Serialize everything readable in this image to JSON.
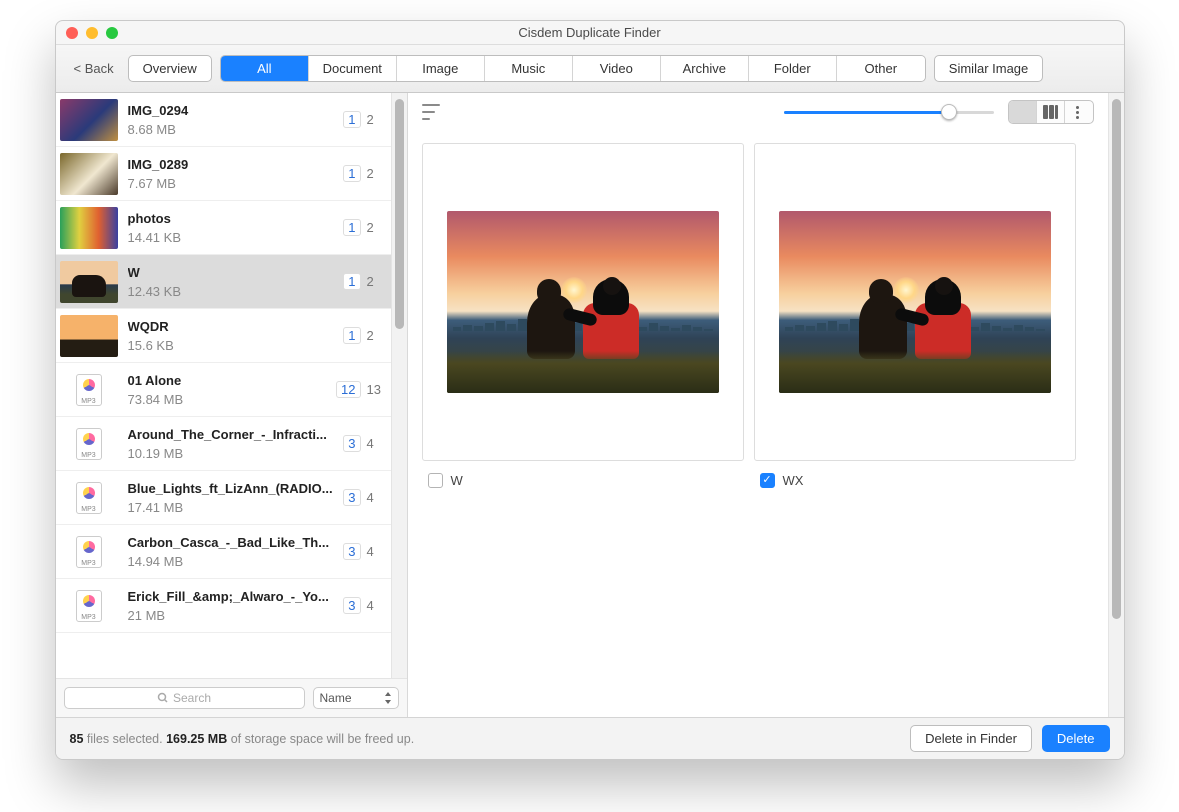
{
  "window": {
    "title": "Cisdem Duplicate Finder"
  },
  "toolbar": {
    "back": "< Back",
    "overview": "Overview",
    "tabs": [
      "All",
      "Document",
      "Image",
      "Music",
      "Video",
      "Archive",
      "Folder",
      "Other"
    ],
    "active_tab_index": 0,
    "similar": "Similar Image"
  },
  "list": {
    "items": [
      {
        "name": "IMG_0294",
        "size": "8.68 MB",
        "sel": "1",
        "tot": "2",
        "kind": "img",
        "thumb": "t0"
      },
      {
        "name": "IMG_0289",
        "size": "7.67 MB",
        "sel": "1",
        "tot": "2",
        "kind": "img",
        "thumb": "t1"
      },
      {
        "name": "photos",
        "size": "14.41 KB",
        "sel": "1",
        "tot": "2",
        "kind": "img",
        "thumb": "t2"
      },
      {
        "name": "W",
        "size": "12.43 KB",
        "sel": "1",
        "tot": "2",
        "kind": "img",
        "thumb": "t3",
        "selected": true
      },
      {
        "name": "WQDR",
        "size": "15.6 KB",
        "sel": "1",
        "tot": "2",
        "kind": "img",
        "thumb": "t4"
      },
      {
        "name": "01 Alone",
        "size": "73.84 MB",
        "sel": "12",
        "tot": "13",
        "kind": "mp3"
      },
      {
        "name": "Around_The_Corner_-_Infracti...",
        "size": "10.19 MB",
        "sel": "3",
        "tot": "4",
        "kind": "mp3"
      },
      {
        "name": "Blue_Lights_ft_LizAnn_(RADIO...",
        "size": "17.41 MB",
        "sel": "3",
        "tot": "4",
        "kind": "mp3"
      },
      {
        "name": "Carbon_Casca_-_Bad_Like_Th...",
        "size": "14.94 MB",
        "sel": "3",
        "tot": "4",
        "kind": "mp3"
      },
      {
        "name": "Erick_Fill_&amp;_Alwaro_-_Yo...",
        "size": "21 MB",
        "sel": "3",
        "tot": "4",
        "kind": "mp3"
      }
    ],
    "search_placeholder": "Search",
    "sort_value": "Name"
  },
  "preview": {
    "slider_pct": 79,
    "cards": [
      {
        "label": "W",
        "checked": false
      },
      {
        "label": "WX",
        "checked": true
      }
    ]
  },
  "footer": {
    "files_count": "85",
    "files_text": " files selected. ",
    "size_freed": "169.25 MB",
    "size_text": " of storage space will be freed up.",
    "delete_finder": "Delete in Finder",
    "delete": "Delete"
  },
  "mp3_label": "MP3"
}
